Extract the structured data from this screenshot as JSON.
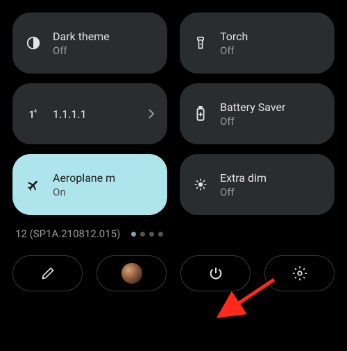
{
  "tiles": [
    {
      "id": "dark-theme",
      "label": "Dark theme",
      "status": "Off",
      "icon": "contrast-icon",
      "active": false
    },
    {
      "id": "torch",
      "label": "Torch",
      "status": "Off",
      "icon": "torch-icon",
      "active": false
    },
    {
      "id": "dns",
      "label": "1.1.1.1",
      "status": "",
      "icon": "signal-icon",
      "active": false,
      "chevron": true
    },
    {
      "id": "battery-saver",
      "label": "Battery Saver",
      "status": "Off",
      "icon": "battery-icon",
      "active": false
    },
    {
      "id": "aeroplane",
      "label": "Aeroplane m",
      "status": "On",
      "icon": "airplane-icon",
      "active": true
    },
    {
      "id": "extra-dim",
      "label": "Extra dim",
      "status": "Off",
      "icon": "dim-icon",
      "active": false
    }
  ],
  "build_text": "12 (SP1A.210812.015)",
  "page_indicator": {
    "total": 4,
    "current": 0
  },
  "bottom_buttons": [
    {
      "id": "edit",
      "icon": "pencil-icon"
    },
    {
      "id": "user",
      "icon": "avatar"
    },
    {
      "id": "power",
      "icon": "power-icon"
    },
    {
      "id": "settings",
      "icon": "gear-icon"
    }
  ],
  "annotation_arrow": {
    "target": "power-button",
    "color": "#ff2a1a"
  }
}
